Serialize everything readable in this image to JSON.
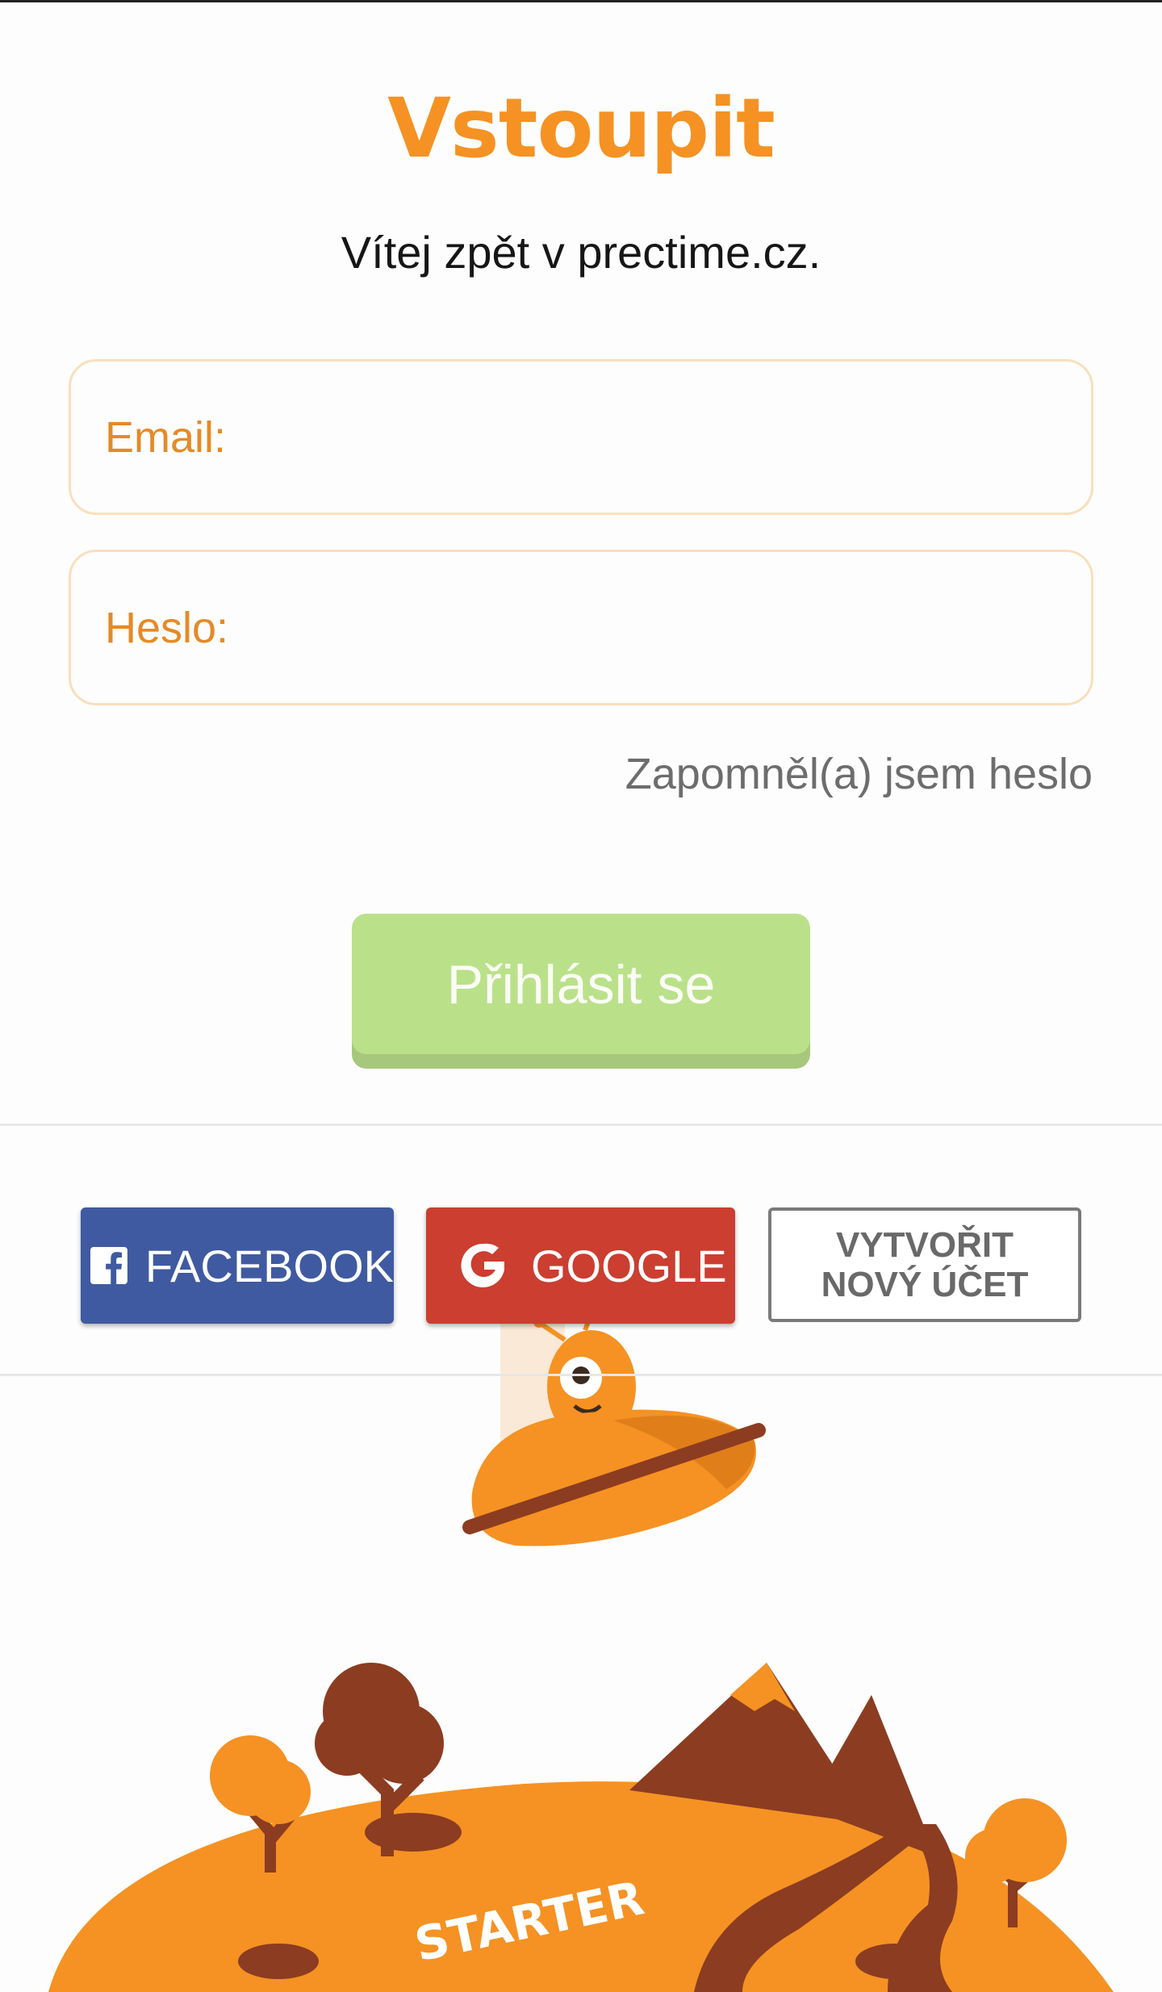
{
  "header": {
    "title": "Vstoupit",
    "subtitle": "Vítej zpět v prectime.cz."
  },
  "form": {
    "email_placeholder": "Email:",
    "password_placeholder": "Heslo:",
    "forgot_password": "Zapomněl(a) jsem heslo",
    "submit_label": "Přihlásit se"
  },
  "social": {
    "facebook_label": "FACEBOOK",
    "google_label": "GOOGLE",
    "create_account_line1": "VYTVOŘIT",
    "create_account_line2": "NOVÝ ÚČET"
  },
  "illustration": {
    "ground_text": "STARTER"
  },
  "colors": {
    "accent_orange": "#f59223",
    "login_green": "#bae18a",
    "facebook_blue": "#3f5aa0",
    "google_red": "#cb3e30"
  }
}
